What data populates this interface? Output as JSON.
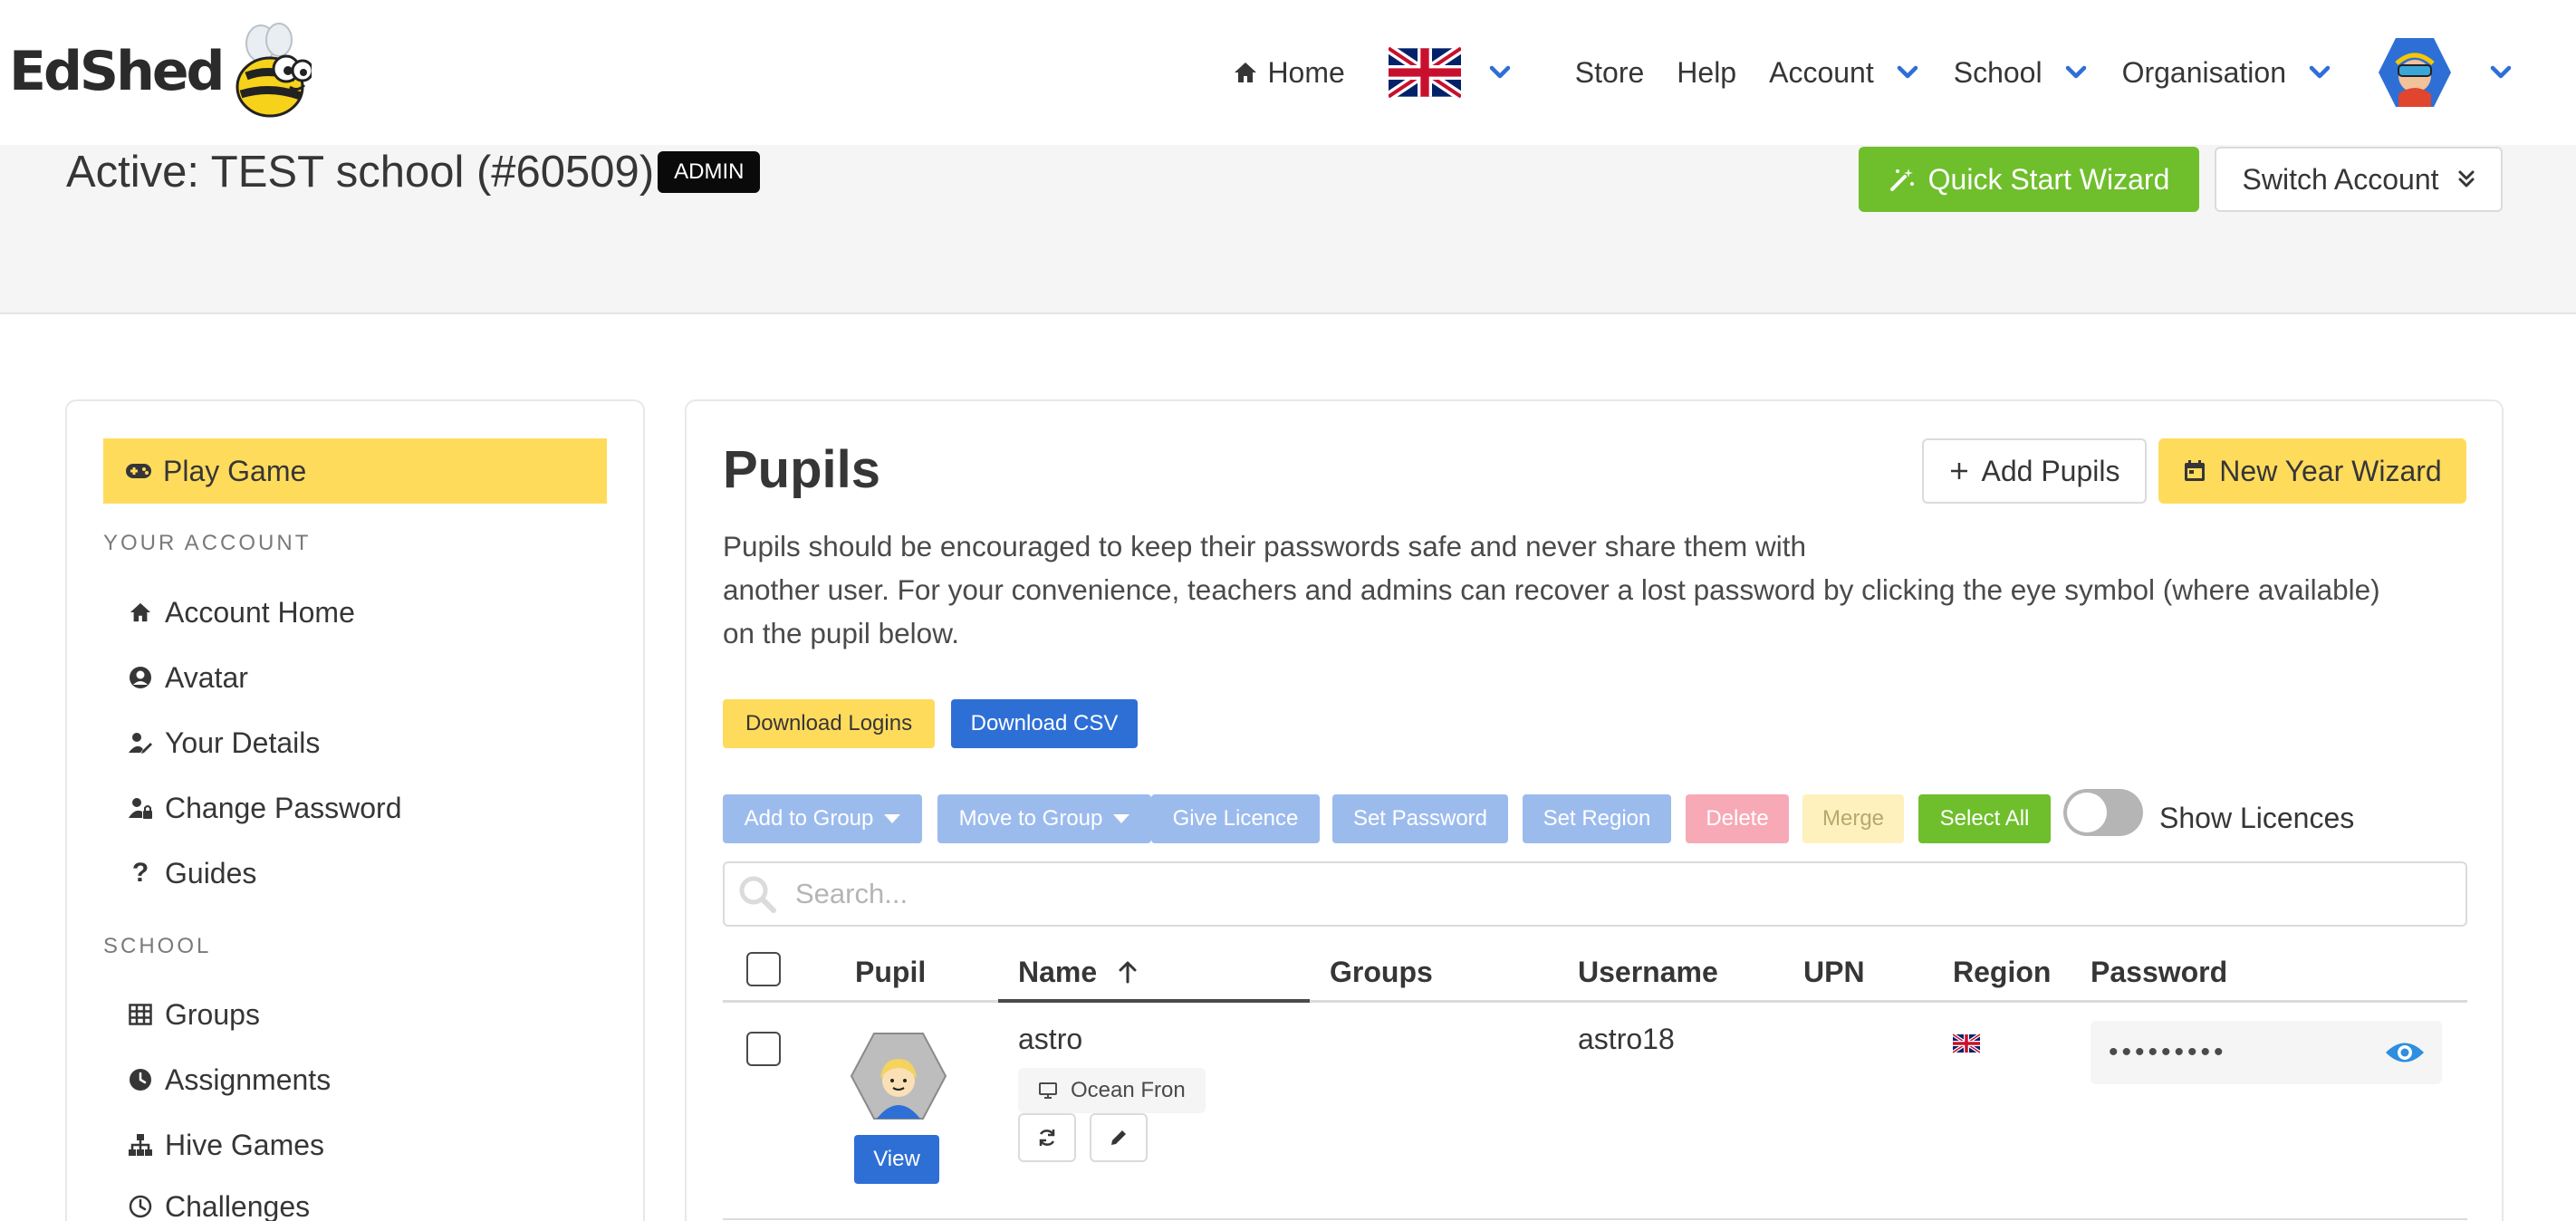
{
  "logo": {
    "text": "EdShed"
  },
  "nav": {
    "home": "Home",
    "store": "Store",
    "help": "Help",
    "account": "Account",
    "school": "School",
    "organisation": "Organisation"
  },
  "hero": {
    "title": "Active: TEST school (#60509)",
    "badge": "ADMIN",
    "quick_start": "Quick Start Wizard",
    "switch_account": "Switch Account"
  },
  "sidebar": {
    "play_game": "Play Game",
    "section_account": "YOUR ACCOUNT",
    "account_items": [
      "Account Home",
      "Avatar",
      "Your Details",
      "Change Password",
      "Guides"
    ],
    "section_school": "SCHOOL",
    "school_items": [
      "Groups",
      "Assignments",
      "Hive Games",
      "Challenges"
    ]
  },
  "main": {
    "title": "Pupils",
    "add_pupils": "Add Pupils",
    "new_year_wizard": "New Year Wizard",
    "description_lines": [
      "Pupils should be encouraged to keep their passwords safe and never share them with",
      "another user. For your convenience, teachers and admins can recover a lost password by clicking the eye symbol (where available)",
      "on the pupil below."
    ],
    "download_logins": "Download Logins",
    "download_csv": "Download CSV",
    "actions": {
      "add_to_group": "Add to Group",
      "move_to_group": "Move to Group",
      "give_licence": "Give Licence",
      "set_password": "Set Password",
      "set_region": "Set Region",
      "delete": "Delete",
      "merge": "Merge",
      "select_all": "Select All"
    },
    "show_licences": "Show Licences",
    "search_placeholder": "Search...",
    "columns": {
      "pupil": "Pupil",
      "name": "Name",
      "groups": "Groups",
      "username": "Username",
      "upn": "UPN",
      "region": "Region",
      "password": "Password"
    },
    "rows": [
      {
        "name": "astro",
        "device": "Ocean Fron",
        "groups": "",
        "username": "astro18",
        "upn": "",
        "password_mask": "•••••••••",
        "view_label": "View"
      }
    ]
  },
  "colors": {
    "yellow": "#ffdb5c",
    "green": "#6fbe2c",
    "blue": "#2e6fd6",
    "light_blue": "#9cbbed",
    "pink": "#f7a9b6"
  }
}
